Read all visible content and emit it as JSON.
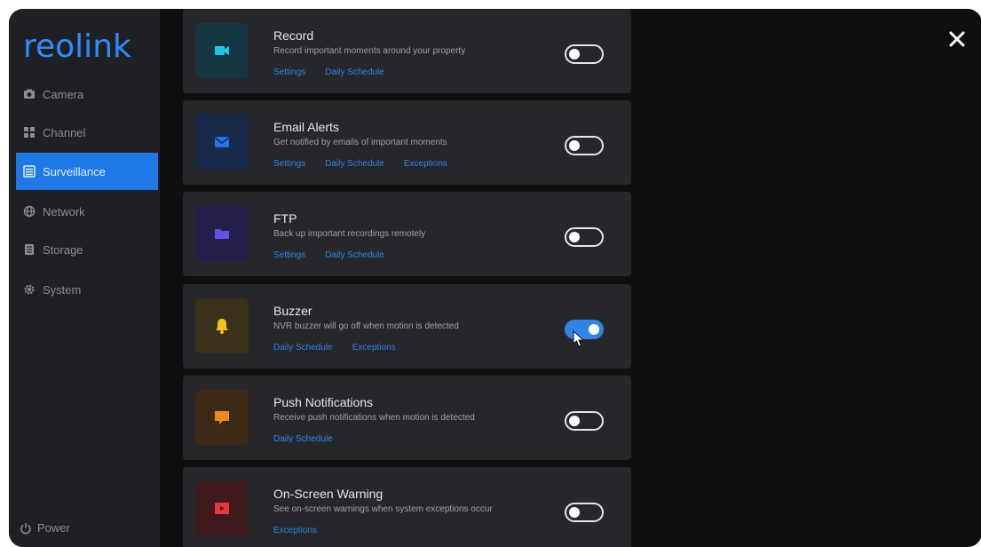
{
  "app": {
    "logo_text": "reolink"
  },
  "sidebar": {
    "items": [
      {
        "label": "Camera",
        "icon": "camera-icon",
        "active": false
      },
      {
        "label": "Channel",
        "icon": "channel-icon",
        "active": false
      },
      {
        "label": "Surveillance",
        "icon": "surveillance-icon",
        "active": true
      },
      {
        "label": "Network",
        "icon": "network-icon",
        "active": false
      },
      {
        "label": "Storage",
        "icon": "storage-icon",
        "active": false
      },
      {
        "label": "System",
        "icon": "gear-icon",
        "active": false
      }
    ],
    "power_label": "Power"
  },
  "cards": [
    {
      "title": "Record",
      "desc": "Record important moments around your property",
      "links": [
        "Settings",
        "Daily Schedule"
      ],
      "toggle": "off",
      "icon": "video-icon",
      "icon_color": "#1ec6e8",
      "icon_bg": "#173643"
    },
    {
      "title": "Email Alerts",
      "desc": "Get notified by emails of important moments",
      "links": [
        "Settings",
        "Daily Schedule",
        "Exceptions"
      ],
      "toggle": "off",
      "icon": "email-icon",
      "icon_color": "#2573e8",
      "icon_bg": "#172a4a"
    },
    {
      "title": "FTP",
      "desc": "Back up important recordings remotely",
      "links": [
        "Settings",
        "Daily Schedule"
      ],
      "toggle": "off",
      "icon": "folder-icon",
      "icon_color": "#5b53e8",
      "icon_bg": "#241f4a"
    },
    {
      "title": "Buzzer",
      "desc": "NVR buzzer will go off when motion is detected",
      "links": [
        "Daily Schedule",
        "Exceptions"
      ],
      "toggle": "on",
      "icon": "bell-icon",
      "icon_color": "#f4c21a",
      "icon_bg": "#3a311a"
    },
    {
      "title": "Push Notifications",
      "desc": "Receive push notifications when motion is detected",
      "links": [
        "Daily Schedule"
      ],
      "toggle": "off",
      "icon": "message-icon",
      "icon_color": "#f08a1a",
      "icon_bg": "#3e2a17"
    },
    {
      "title": "On-Screen Warning",
      "desc": "See on-screen warnings when system exceptions occur",
      "links": [
        "Exceptions"
      ],
      "toggle": "off",
      "icon": "warning-screen-icon",
      "icon_color": "#e83a3a",
      "icon_bg": "#3e1a1d"
    }
  ],
  "colors": {
    "accent": "#1e78e6",
    "link": "#2f84e8"
  }
}
